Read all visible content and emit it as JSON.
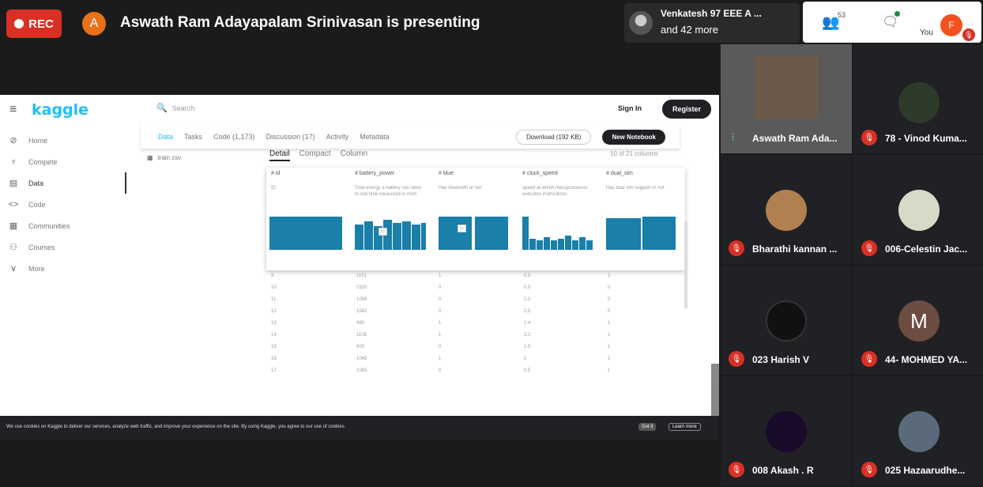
{
  "meeting": {
    "rec_label": "REC",
    "presenter_initial": "A",
    "presenting_title": "Aswath Ram Adayapalam Srinivasan is presenting",
    "others_line1": "Venkatesh 97 EEE A ...",
    "others_line2": "and 42 more",
    "people_count": "53",
    "you_label": "You",
    "you_initial": "F"
  },
  "kaggle": {
    "logo": "kaggle",
    "search_placeholder": "Search",
    "signin": "Sign In",
    "register": "Register",
    "nav": [
      {
        "label": "Home",
        "icon": "⊘"
      },
      {
        "label": "Compete",
        "icon": "♆"
      },
      {
        "label": "Data",
        "icon": "▤"
      },
      {
        "label": "Code",
        "icon": "<>"
      },
      {
        "label": "Communities",
        "icon": "▦"
      },
      {
        "label": "Courses",
        "icon": "⚇"
      },
      {
        "label": "More",
        "icon": "∨"
      }
    ],
    "tabs": [
      "Data",
      "Tasks",
      "Code (1,173)",
      "Discussion (17)",
      "Activity",
      "Metadata"
    ],
    "download": "Download (192 KB)",
    "new_notebook": "New Notebook",
    "file": "train.csv",
    "subtabs": [
      "Detail",
      "Compact",
      "Column"
    ],
    "col_count": "10 of 21 columns",
    "columns": [
      {
        "header": "# id",
        "desc": "ID"
      },
      {
        "header": "# battery_power",
        "desc": "Total energy a battery can store in one time measured in mAh"
      },
      {
        "header": "# blue",
        "desc": "Has bluetooth or not"
      },
      {
        "header": "# clock_speed",
        "desc": "speed at which microprocessor executes instructions"
      },
      {
        "header": "# dual_sim",
        "desc": "Has dual sim support or not"
      }
    ],
    "rows": [
      [
        "9",
        "1101",
        "1",
        "0.5",
        "1"
      ],
      [
        "10",
        "1520",
        "0",
        "0.5",
        "0"
      ],
      [
        "11",
        "1066",
        "0",
        "2.2",
        "0"
      ],
      [
        "12",
        "1582",
        "0",
        "2.5",
        "0"
      ],
      [
        "13",
        "960",
        "1",
        "1.4",
        "1"
      ],
      [
        "14",
        "1108",
        "1",
        "2.2",
        "1"
      ],
      [
        "15",
        "600",
        "0",
        "1.9",
        "1"
      ],
      [
        "16",
        "1045",
        "1",
        "1",
        "1"
      ],
      [
        "17",
        "1083",
        "0",
        "0.5",
        "1"
      ]
    ],
    "cookie_text": "We use cookies on Kaggle to deliver our services, analyze web traffic, and improve your experience on the site. By using Kaggle, you agree to our use of cookies.",
    "cookie_ok": "Got it",
    "cookie_learn": "Learn more"
  },
  "participants": [
    {
      "name": "Aswath Ram Ada...",
      "muted": false
    },
    {
      "name": "78 - Vinod Kuma...",
      "muted": true
    },
    {
      "name": "Bharathi kannan ...",
      "muted": true
    },
    {
      "name": "006-Celestin Jac...",
      "muted": true
    },
    {
      "name": "023 Harish V",
      "muted": true
    },
    {
      "name": "44- MOHMED YA...",
      "muted": true,
      "initial": "M"
    },
    {
      "name": "008 Akash . R",
      "muted": true
    },
    {
      "name": "025 Hazaarudhe...",
      "muted": true
    }
  ],
  "colors": {
    "accent": "#20beff",
    "rec": "#d93025",
    "bar": "#1a7fa9"
  }
}
